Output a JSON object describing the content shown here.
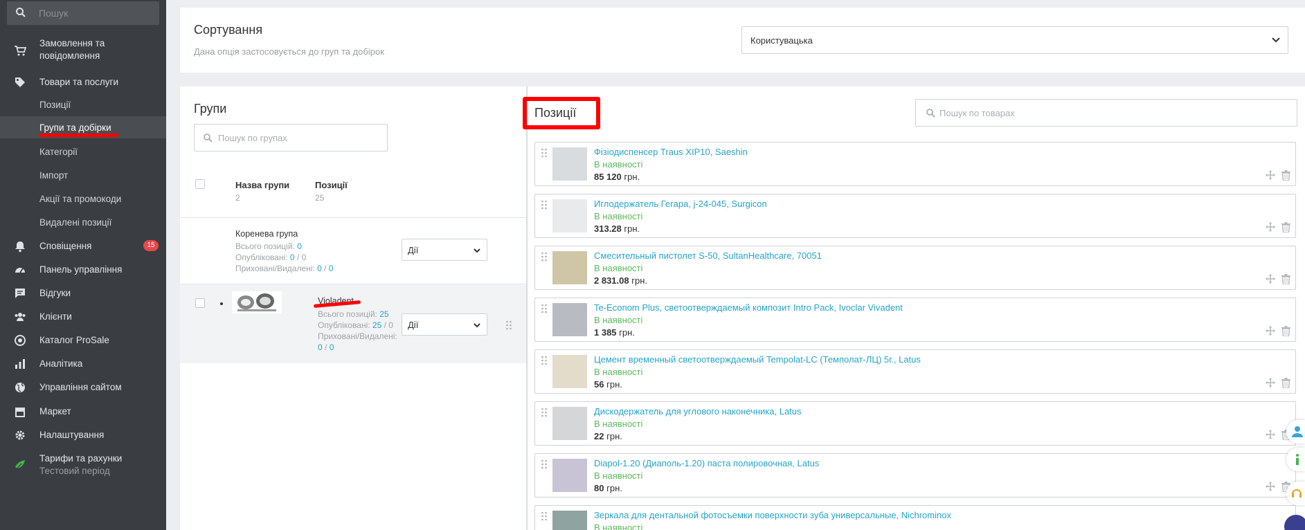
{
  "sidebar": {
    "search_placeholder": "Пошук",
    "items": [
      {
        "label": "Замовлення та",
        "label2": "повідомлення"
      },
      {
        "label": "Товари та послуги"
      },
      {
        "label": "Позиції"
      },
      {
        "label": "Групи та добірки"
      },
      {
        "label": "Категорії"
      },
      {
        "label": "Імпорт"
      },
      {
        "label": "Акції та промокоди"
      },
      {
        "label": "Видалені позиції"
      },
      {
        "label": "Сповіщення",
        "badge": "15"
      },
      {
        "label": "Панель управління"
      },
      {
        "label": "Відгуки"
      },
      {
        "label": "Клієнти"
      },
      {
        "label": "Каталог ProSale"
      },
      {
        "label": "Аналітика"
      },
      {
        "label": "Управління сайтом"
      },
      {
        "label": "Маркет"
      },
      {
        "label": "Налаштування"
      },
      {
        "label": "Тарифи та рахунки",
        "label2": "Тестовий період"
      }
    ]
  },
  "sorting": {
    "title": "Сортування",
    "hint": "Дана опція застосовується до груп та добірок",
    "selected": "Користувацька"
  },
  "groups": {
    "title": "Групи",
    "search_placeholder": "Пошук по групах",
    "col_name": "Назва групи",
    "col_name_count": "2",
    "col_positions": "Позиції",
    "col_positions_count": "25",
    "root": {
      "name": "Коренева група",
      "total_label": "Всього позицій:",
      "total": "0",
      "published_label": "Опубліковані:",
      "published": "0",
      "published_of": "0",
      "hidden_label": "Приховані/Видалені:",
      "hidden": "0",
      "deleted": "0",
      "action": "Дії"
    },
    "row": {
      "name": "Violadent",
      "total_label": "Всього позицій:",
      "total": "25",
      "published_label": "Опубліковані:",
      "published": "25",
      "published_of": "0",
      "hidden_label": "Приховані/Видалені:",
      "hidden": "0",
      "deleted": "0",
      "action": "Дії"
    }
  },
  "positions": {
    "title": "Позиції",
    "search_placeholder": "Пошук по товарах",
    "items": [
      {
        "name": "Фізіодиспенсер Traus XIP10, Saeshin",
        "status": "В наявності",
        "price": "85 120",
        "currency": "грн."
      },
      {
        "name": "Иглодержатель Гегара, j-24-045, Surgicon",
        "status": "В наявності",
        "price": "313.28",
        "currency": "грн."
      },
      {
        "name": "Смесительный пистолет S-50, SultanHealthcare, 70051",
        "status": "В наявності",
        "price": "2 831.08",
        "currency": "грн."
      },
      {
        "name": "Te-Econom Plus, светоотверждаемый композит Intro Pack, Ivoclar Vivadent",
        "status": "В наявності",
        "price": "1 385",
        "currency": "грн."
      },
      {
        "name": "Цемент временный светоотверждаемый Tempolat-LC (Темполат-ЛЦ) 5г., Latus",
        "status": "В наявності",
        "price": "56",
        "currency": "грн."
      },
      {
        "name": "Дискодержатель для углового наконечника, Latus",
        "status": "В наявності",
        "price": "22",
        "currency": "грн."
      },
      {
        "name": "Diapol-1.20 (Диаполь-1.20) паста полировочная, Latus",
        "status": "В наявності",
        "price": "80",
        "currency": "грн."
      },
      {
        "name": "Зеркала для дентальной фотосъемки поверхности зуба универсальные, Nichrominox",
        "status": "В наявності",
        "price": "",
        "currency": ""
      }
    ]
  },
  "colors": {
    "sidebar_bg": "#3a3d42",
    "link": "#25a4c9",
    "in_stock": "#5cb85c",
    "annotation": "#ff0000",
    "badge": "#e8474b"
  }
}
